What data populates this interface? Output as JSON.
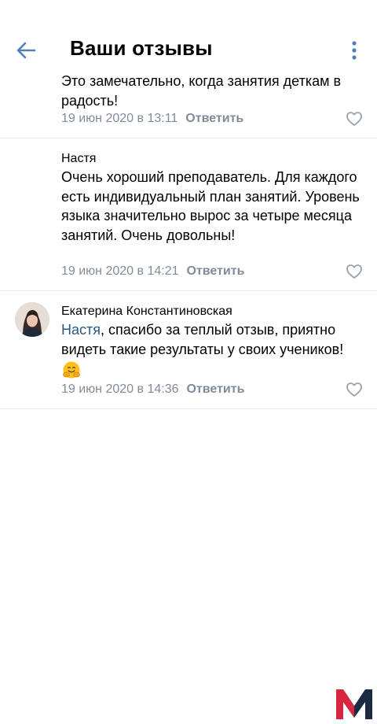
{
  "header": {
    "title": "Ваши отзывы"
  },
  "comments": [
    {
      "text": "Это замечательно, когда занятия деткам в радость!",
      "date": "19 июн 2020 в 13:11",
      "reply_label": "Ответить"
    },
    {
      "author": "Настя",
      "text": "Очень хороший преподаватель. Для каждого есть индивидуальный план занятий. Уровень языка значительно вырос за четыре месяца занятий. Очень довольны!",
      "date": "19 июн 2020 в 14:21",
      "reply_label": "Ответить"
    },
    {
      "author": "Екатерина Константиновская",
      "mention": "Настя",
      "text": ", спасибо за теплый отзыв, приятно видеть такие результаты у своих учеников!",
      "emoji": "hugging-face",
      "date": "19 июн 2020 в 14:36",
      "reply_label": "Ответить"
    }
  ],
  "colors": {
    "accent": "#5181b8",
    "meta": "#818c99",
    "mention": "#2a5885",
    "logo_red": "#d7263d",
    "logo_dark": "#1d2a44"
  },
  "icons": [
    "arrow-left-icon",
    "more-vertical-icon",
    "heart-icon",
    "hugging-face-emoji",
    "m-logo"
  ]
}
